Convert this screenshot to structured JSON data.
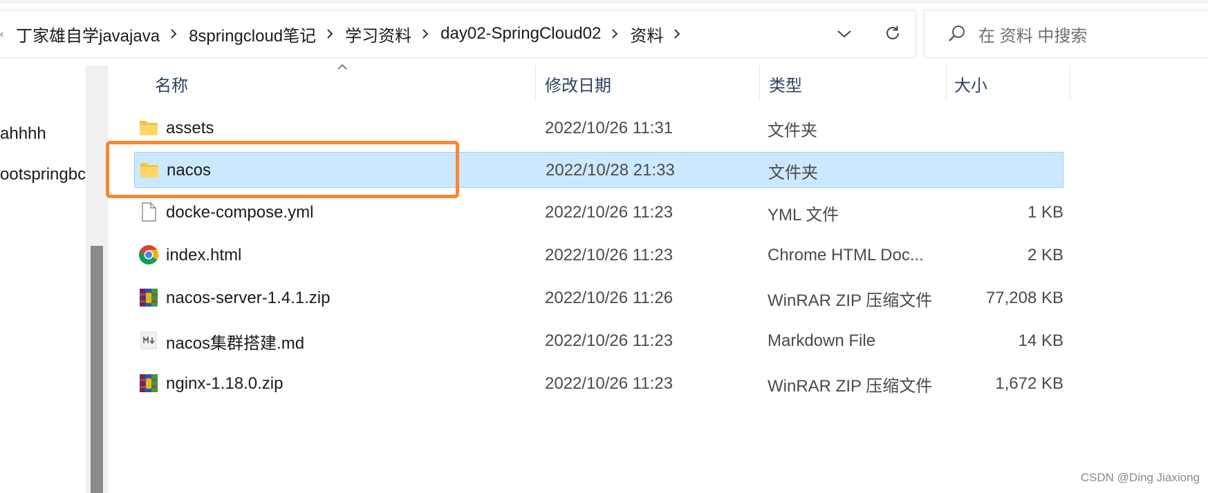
{
  "address_bar": {
    "breadcrumbs": [
      "丁家雄自学javajava",
      "8springcloud笔记",
      "学习资料",
      "day02-SpringCloud02",
      "资料"
    ],
    "lead_glyph": "‹"
  },
  "search": {
    "placeholder": "在 资料 中搜索"
  },
  "nav_pane": {
    "items": [
      "ahhhh",
      "ootspringbc"
    ]
  },
  "columns": {
    "name": "名称",
    "modified": "修改日期",
    "type": "类型",
    "size": "大小"
  },
  "files": [
    {
      "name": "assets",
      "modified": "2022/10/26 11:31",
      "type": "文件夹",
      "size": "",
      "icon": "folder-icon",
      "selected": false
    },
    {
      "name": "nacos",
      "modified": "2022/10/28 21:33",
      "type": "文件夹",
      "size": "",
      "icon": "folder-icon",
      "selected": true
    },
    {
      "name": "docke-compose.yml",
      "modified": "2022/10/26 11:23",
      "type": "YML 文件",
      "size": "1 KB",
      "icon": "file-icon",
      "selected": false
    },
    {
      "name": "index.html",
      "modified": "2022/10/26 11:23",
      "type": "Chrome HTML Doc...",
      "size": "2 KB",
      "icon": "chrome-icon",
      "selected": false
    },
    {
      "name": "nacos-server-1.4.1.zip",
      "modified": "2022/10/26 11:26",
      "type": "WinRAR ZIP 压缩文件",
      "size": "77,208 KB",
      "icon": "winrar-icon",
      "selected": false
    },
    {
      "name": "nacos集群搭建.md",
      "modified": "2022/10/26 11:23",
      "type": "Markdown File",
      "size": "14 KB",
      "icon": "markdown-icon",
      "selected": false
    },
    {
      "name": "nginx-1.18.0.zip",
      "modified": "2022/10/26 11:23",
      "type": "WinRAR ZIP 压缩文件",
      "size": "1,672 KB",
      "icon": "winrar-icon",
      "selected": false
    }
  ],
  "watermark": "CSDN @Ding Jiaxiong",
  "colors": {
    "selection": "#cce8ff",
    "selection_border": "#99d1ff",
    "highlight": "#fb8631",
    "header_text": "#2b4260"
  }
}
